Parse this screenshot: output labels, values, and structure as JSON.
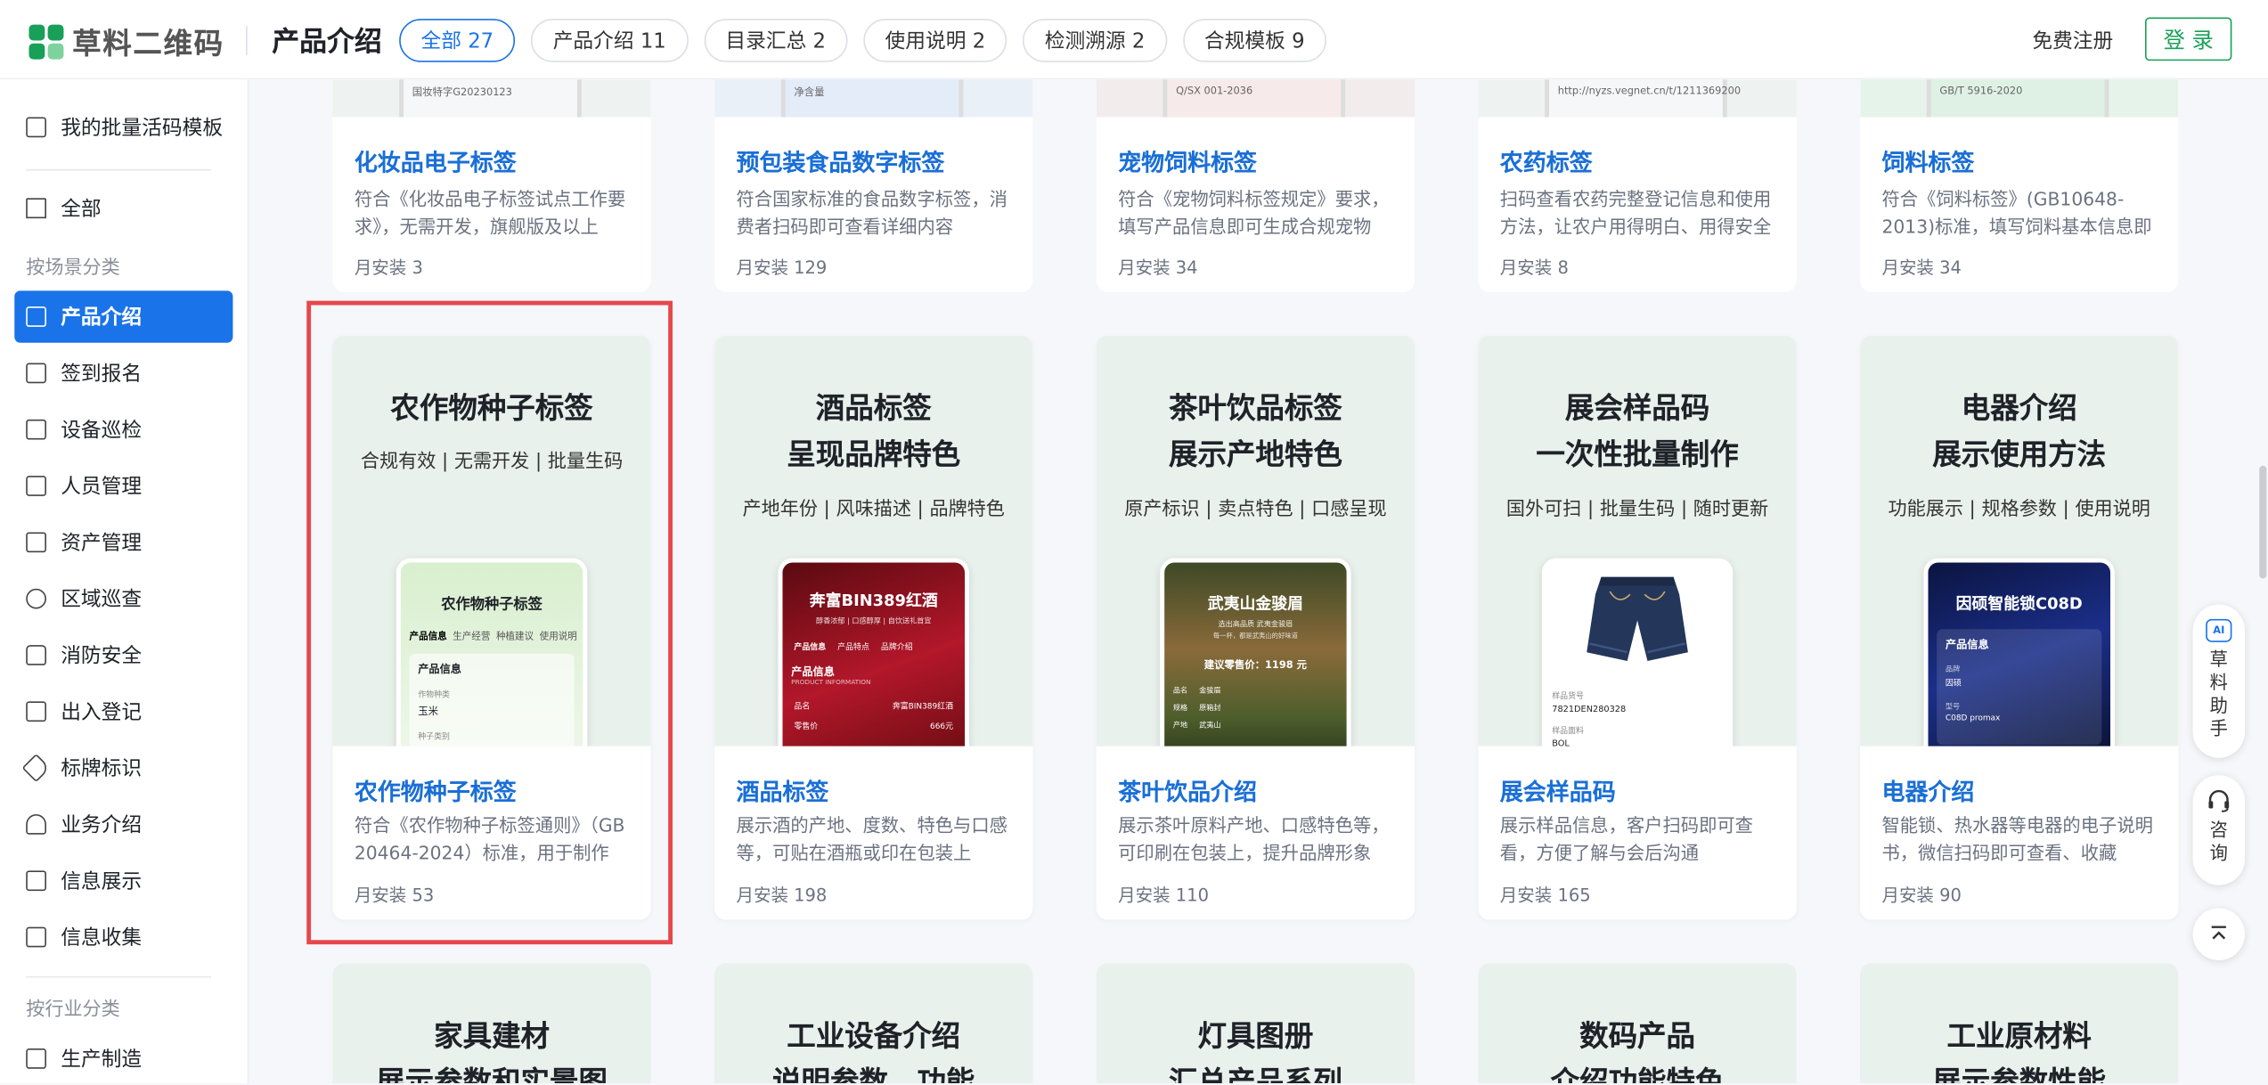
{
  "header": {
    "brand": "草料二维码",
    "page_title": "产品介绍",
    "tabs": [
      {
        "label": "全部 27",
        "active": true
      },
      {
        "label": "产品介绍 11"
      },
      {
        "label": "目录汇总 2"
      },
      {
        "label": "使用说明 2"
      },
      {
        "label": "检测溯源 2"
      },
      {
        "label": "合规模板 9"
      }
    ],
    "register": "免费注册",
    "login": "登 录"
  },
  "sidebar": {
    "my_templates": "我的批量活码模板",
    "all": "全部",
    "group_scene": "按场景分类",
    "items": [
      "产品介绍",
      "签到报名",
      "设备巡检",
      "人员管理",
      "资产管理",
      "区域巡查",
      "消防安全",
      "出入登记",
      "标牌标识",
      "业务介绍",
      "信息展示",
      "信息收集"
    ],
    "group_industry": "按行业分类",
    "industry_items": [
      "生产制造"
    ]
  },
  "top_cards": [
    {
      "title": "化妆品电子标签",
      "desc": "符合《化妆品电子标签试点工作要求》，无需开发，旗舰版及以上可...",
      "stat": "月安装  3",
      "strip": "国妆特字G20230123"
    },
    {
      "title": "预包装食品数字标签",
      "desc": "符合国家标准的食品数字标签，消费者扫码即可查看详细内容",
      "stat": "月安装  129",
      "strip": "净含量"
    },
    {
      "title": "宠物饲料标签",
      "desc": "符合《宠物饲料标签规定》要求，填写产品信息即可生成合规宠物饲...",
      "stat": "月安装  34",
      "strip": "Q/SX 001-2036"
    },
    {
      "title": "农药标签",
      "desc": "扫码查看农药完整登记信息和使用方法，让农户用得明白、用得安全",
      "stat": "月安装  8",
      "strip": "http://nyzs.vegnet.cn/t/1211369200"
    },
    {
      "title": "饲料标签",
      "desc": "符合《饲料标签》(GB10648-2013)标准，填写饲料基本信息即可生成...",
      "stat": "月安装  34",
      "strip": "GB/T 5916-2020"
    }
  ],
  "cards": [
    {
      "hero_lines": [
        "农作物种子标签"
      ],
      "hero_sub": "合规有效 | 无需开发 | 批量生码",
      "title": "农作物种子标签",
      "desc": "符合《农作物种子标签通则》（GB 20464-2024）标准，用于制作规...",
      "stat": "月安装  53",
      "phone": {
        "title": "农作物种子标签",
        "tabs": [
          "产品信息",
          "生产经营",
          "种植建议",
          "使用说明"
        ],
        "section": "产品信息",
        "label": "作物种类",
        "value": "玉米",
        "label2": "种子类别"
      }
    },
    {
      "hero_lines": [
        "酒品标签",
        "呈现品牌特色"
      ],
      "hero_sub": "产地年份 | 风味描述 | 品牌特色",
      "title": "酒品标签",
      "desc": "展示酒的产地、度数、特色与口感等，可贴在酒瓶或印在包装上",
      "stat": "月安装  198",
      "phone": {
        "title": "奔富BIN389红酒",
        "sub": "醇香浓郁 | 口感醇厚 | 自饮送礼首宜",
        "tabs": [
          "产品信息",
          "产品特点",
          "品牌介绍"
        ],
        "section": "产品信息",
        "section_en": "PRODUCT INFORMATION",
        "row1": [
          "品名",
          "奔富BIN389红酒"
        ],
        "row2": [
          "零售价",
          "666元"
        ]
      }
    },
    {
      "hero_lines": [
        "茶叶饮品标签",
        "展示产地特色"
      ],
      "hero_sub": "原产标识 | 卖点特色 | 口感呈现",
      "title": "茶叶饮品介绍",
      "desc": "展示茶叶原料产地、口感特色等，可印刷在包装上，提升品牌形象",
      "stat": "月安装  110",
      "phone": {
        "title": "武夷山金骏眉",
        "sub": "选出高品质 武夷金骏眉",
        "sub2": "每一杯，都是武夷山的好味道",
        "price": "建议零售价：1198 元",
        "r1": [
          "品名",
          "金骏眉"
        ],
        "r2": [
          "规格",
          "原箱封"
        ],
        "r3": [
          "产地",
          "武夷山"
        ]
      }
    },
    {
      "hero_lines": [
        "展会样品码",
        "一次性批量制作"
      ],
      "hero_sub": "国外可扫 | 批量生码 | 随时更新",
      "title": "展会样品码",
      "desc": "展示样品信息，客户扫码即可查看，方便了解与会后沟通",
      "stat": "月安装  165",
      "phone": {
        "l1": "样品货号",
        "v1": "7821DEN280328",
        "l2": "样品面料",
        "v2": "BOL"
      }
    },
    {
      "hero_lines": [
        "电器介绍",
        "展示使用方法"
      ],
      "hero_sub": "功能展示 | 规格参数 | 使用说明",
      "title": "电器介绍",
      "desc": "智能锁、热水器等电器的电子说明书，微信扫码即可查看、收藏",
      "stat": "月安装  90",
      "phone": {
        "title": "因硕智能锁C08D",
        "section": "产品信息",
        "l1": "品牌",
        "v1": "因硕",
        "l2": "型号",
        "v2": "C08D promax"
      }
    }
  ],
  "bottom_cards": [
    {
      "l1": "家具建材",
      "l2": "展示参数和实景图"
    },
    {
      "l1": "工业设备介绍",
      "l2": "说明参数、功能"
    },
    {
      "l1": "灯具图册",
      "l2": "汇总产品系列"
    },
    {
      "l1": "数码产品",
      "l2": "介绍功能特色"
    },
    {
      "l1": "工业原材料",
      "l2": "展示参数性能"
    }
  ],
  "float": {
    "assistant": "草料助手",
    "ai_badge": "AI",
    "consult": "咨询"
  },
  "colors": {
    "brand_green": "#18a058",
    "accent_blue": "#1a73e8",
    "highlight_red": "#e5484d"
  }
}
